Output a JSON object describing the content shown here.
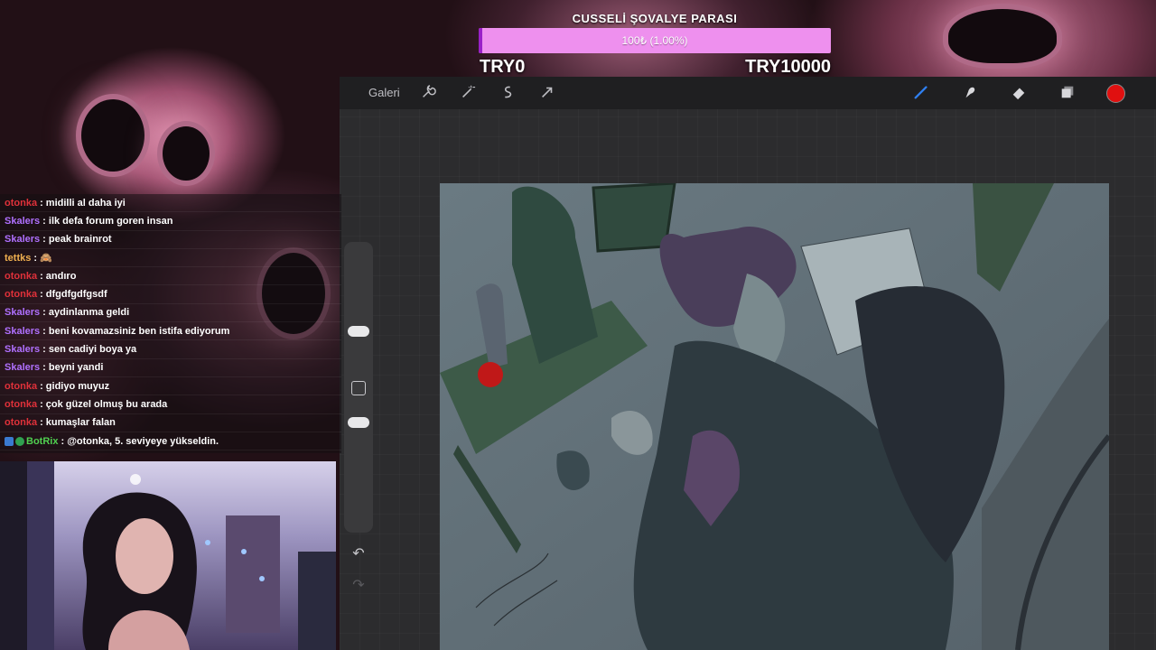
{
  "goal": {
    "title": "CUSSELİ ŞOVALYE PARASI",
    "progress_text": "100₺ (1.00%)",
    "progress_fraction": 0.01,
    "min_label": "TRY0",
    "max_label": "TRY10000",
    "fill_color": "#ee90ee",
    "accent_color": "#9a20c8"
  },
  "procreate": {
    "gallery_label": "Galeri",
    "left_tools": [
      "wrench-icon",
      "magic-wand-icon",
      "selection-icon",
      "transform-icon"
    ],
    "right_tools": [
      "brush-icon",
      "smudge-icon",
      "eraser-icon",
      "layers-icon"
    ],
    "current_color": "#e01010"
  },
  "chat": {
    "messages": [
      {
        "user": "otonka",
        "user_color": "#e0313a",
        "text": "midilli al daha iyi"
      },
      {
        "user": "Skalers",
        "user_color": "#b070ff",
        "text": "ilk defa forum goren insan"
      },
      {
        "user": "Skalers",
        "user_color": "#b070ff",
        "text": "peak brainrot"
      },
      {
        "user": "tettks",
        "user_color": "#f0b050",
        "text": "🙈"
      },
      {
        "user": "otonka",
        "user_color": "#e0313a",
        "text": "andıro"
      },
      {
        "user": "otonka",
        "user_color": "#e0313a",
        "text": "dfgdfgdfgsdf"
      },
      {
        "user": "Skalers",
        "user_color": "#b070ff",
        "text": "aydinlanma geldi"
      },
      {
        "user": "Skalers",
        "user_color": "#b070ff",
        "text": "beni kovamazsiniz ben istifa ediyorum"
      },
      {
        "user": "Skalers",
        "user_color": "#b070ff",
        "text": "sen cadiyi boya ya"
      },
      {
        "user": "Skalers",
        "user_color": "#b070ff",
        "text": "beyni yandi"
      },
      {
        "user": "otonka",
        "user_color": "#e0313a",
        "text": "gidiyo muyuz"
      },
      {
        "user": "otonka",
        "user_color": "#e0313a",
        "text": "çok güzel olmuş bu arada"
      },
      {
        "user": "otonka",
        "user_color": "#e0313a",
        "text": "kumaşlar falan"
      },
      {
        "user": "BotRix",
        "user_color": "#50d050",
        "text": "@otonka, 5. seviyeye yükseldin.",
        "badges": true
      }
    ]
  }
}
